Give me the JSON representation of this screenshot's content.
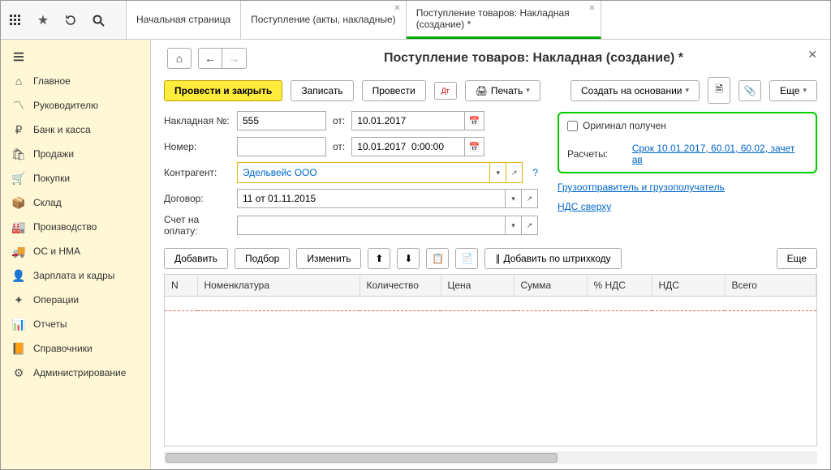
{
  "top": {
    "tabs": [
      {
        "label": "Начальная страница",
        "closable": false
      },
      {
        "label": "Поступление (акты, накладные)",
        "closable": true
      },
      {
        "label": "Поступление товаров: Накладная (создание) *",
        "closable": true,
        "active": true
      }
    ]
  },
  "sidebar": [
    {
      "icon": "menu",
      "label": ""
    },
    {
      "icon": "home",
      "label": "Главное"
    },
    {
      "icon": "chart",
      "label": "Руководителю"
    },
    {
      "icon": "bank",
      "label": "Банк и касса"
    },
    {
      "icon": "sales",
      "label": "Продажи"
    },
    {
      "icon": "cart",
      "label": "Покупки"
    },
    {
      "icon": "box",
      "label": "Склад"
    },
    {
      "icon": "factory",
      "label": "Производство"
    },
    {
      "icon": "truck",
      "label": "ОС и НМА"
    },
    {
      "icon": "person",
      "label": "Зарплата и кадры"
    },
    {
      "icon": "ops",
      "label": "Операции"
    },
    {
      "icon": "report",
      "label": "Отчеты"
    },
    {
      "icon": "book",
      "label": "Справочники"
    },
    {
      "icon": "gear",
      "label": "Администрирование"
    }
  ],
  "page": {
    "title": "Поступление товаров: Накладная (создание) *"
  },
  "cmd": {
    "postClose": "Провести и закрыть",
    "save": "Записать",
    "post": "Провести",
    "print": "Печать",
    "createBased": "Создать на основании",
    "more": "Еще"
  },
  "form": {
    "invoiceLabel": "Накладная №:",
    "invoiceNo": "555",
    "fromLabel": "от:",
    "date1": "10.01.2017",
    "numberLabel": "Номер:",
    "numberVal": "",
    "dateTime": "10.01.2017  0:00:00",
    "counterLabel": "Контрагент:",
    "counterVal": "Эдельвейс ООО",
    "contractLabel": "Договор:",
    "contractVal": "11 от 01.11.2015",
    "billLabel": "Счет на оплату:",
    "billVal": ""
  },
  "rightBox": {
    "originalChk": "Оригинал получен",
    "calcLabel": "Расчеты:",
    "calcLink": "Срок 10.01.2017, 60.01, 60.02, зачет ав"
  },
  "rightLinks": {
    "shipper": "Грузоотправитель и грузополучатель",
    "vat": "НДС сверху"
  },
  "tblToolbar": {
    "add": "Добавить",
    "pick": "Подбор",
    "edit": "Изменить",
    "barcode": "Добавить по штрихкоду",
    "more": "Еще"
  },
  "tblHeaders": {
    "n": "N",
    "nomen": "Номенклатура",
    "qty": "Количество",
    "price": "Цена",
    "sum": "Сумма",
    "vatpct": "% НДС",
    "vat": "НДС",
    "total": "Всего"
  }
}
